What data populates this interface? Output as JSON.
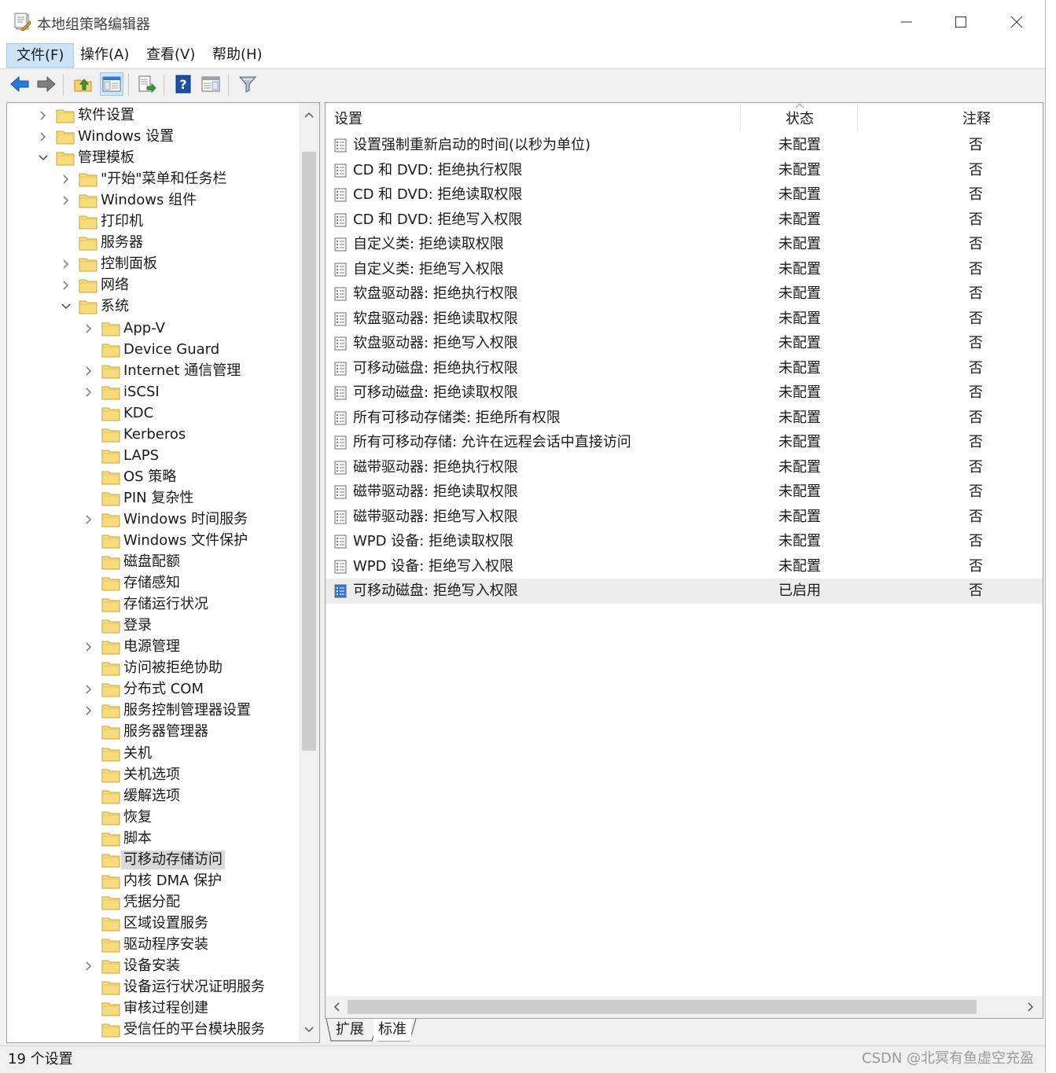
{
  "window": {
    "title": "本地组策略编辑器"
  },
  "menubar": [
    "文件(F)",
    "操作(A)",
    "查看(V)",
    "帮助(H)"
  ],
  "tree": {
    "items": [
      {
        "label": "软件设置",
        "depth": 1,
        "chevron": "right"
      },
      {
        "label": "Windows 设置",
        "depth": 1,
        "chevron": "right"
      },
      {
        "label": "管理模板",
        "depth": 1,
        "chevron": "down"
      },
      {
        "label": "\"开始\"菜单和任务栏",
        "depth": 2,
        "chevron": "right"
      },
      {
        "label": "Windows 组件",
        "depth": 2,
        "chevron": "right"
      },
      {
        "label": "打印机",
        "depth": 2,
        "chevron": "none"
      },
      {
        "label": "服务器",
        "depth": 2,
        "chevron": "none"
      },
      {
        "label": "控制面板",
        "depth": 2,
        "chevron": "right"
      },
      {
        "label": "网络",
        "depth": 2,
        "chevron": "right"
      },
      {
        "label": "系统",
        "depth": 2,
        "chevron": "down"
      },
      {
        "label": "App-V",
        "depth": 3,
        "chevron": "right"
      },
      {
        "label": "Device Guard",
        "depth": 3,
        "chevron": "none"
      },
      {
        "label": "Internet 通信管理",
        "depth": 3,
        "chevron": "right"
      },
      {
        "label": "iSCSI",
        "depth": 3,
        "chevron": "right"
      },
      {
        "label": "KDC",
        "depth": 3,
        "chevron": "none"
      },
      {
        "label": "Kerberos",
        "depth": 3,
        "chevron": "none"
      },
      {
        "label": "LAPS",
        "depth": 3,
        "chevron": "none"
      },
      {
        "label": "OS 策略",
        "depth": 3,
        "chevron": "none"
      },
      {
        "label": "PIN 复杂性",
        "depth": 3,
        "chevron": "none"
      },
      {
        "label": "Windows 时间服务",
        "depth": 3,
        "chevron": "right"
      },
      {
        "label": "Windows 文件保护",
        "depth": 3,
        "chevron": "none"
      },
      {
        "label": "磁盘配额",
        "depth": 3,
        "chevron": "none"
      },
      {
        "label": "存储感知",
        "depth": 3,
        "chevron": "none"
      },
      {
        "label": "存储运行状况",
        "depth": 3,
        "chevron": "none"
      },
      {
        "label": "登录",
        "depth": 3,
        "chevron": "none"
      },
      {
        "label": "电源管理",
        "depth": 3,
        "chevron": "right"
      },
      {
        "label": "访问被拒绝协助",
        "depth": 3,
        "chevron": "none"
      },
      {
        "label": "分布式 COM",
        "depth": 3,
        "chevron": "right"
      },
      {
        "label": "服务控制管理器设置",
        "depth": 3,
        "chevron": "right"
      },
      {
        "label": "服务器管理器",
        "depth": 3,
        "chevron": "none"
      },
      {
        "label": "关机",
        "depth": 3,
        "chevron": "none"
      },
      {
        "label": "关机选项",
        "depth": 3,
        "chevron": "none"
      },
      {
        "label": "缓解选项",
        "depth": 3,
        "chevron": "none"
      },
      {
        "label": "恢复",
        "depth": 3,
        "chevron": "none"
      },
      {
        "label": "脚本",
        "depth": 3,
        "chevron": "none"
      },
      {
        "label": "可移动存储访问",
        "depth": 3,
        "chevron": "none",
        "selected": true
      },
      {
        "label": "内核 DMA 保护",
        "depth": 3,
        "chevron": "none"
      },
      {
        "label": "凭据分配",
        "depth": 3,
        "chevron": "none"
      },
      {
        "label": "区域设置服务",
        "depth": 3,
        "chevron": "none"
      },
      {
        "label": "驱动程序安装",
        "depth": 3,
        "chevron": "none"
      },
      {
        "label": "设备安装",
        "depth": 3,
        "chevron": "right"
      },
      {
        "label": "设备运行状况证明服务",
        "depth": 3,
        "chevron": "none"
      },
      {
        "label": "审核过程创建",
        "depth": 3,
        "chevron": "none"
      },
      {
        "label": "受信任的平台模块服务",
        "depth": 3,
        "chevron": "none"
      }
    ]
  },
  "list": {
    "columns": {
      "setting": "设置",
      "state": "状态",
      "comment": "注释"
    },
    "rows": [
      {
        "name": "设置强制重新启动的时间(以秒为单位)",
        "state": "未配置",
        "comment": "否"
      },
      {
        "name": "CD 和 DVD: 拒绝执行权限",
        "state": "未配置",
        "comment": "否"
      },
      {
        "name": "CD 和 DVD: 拒绝读取权限",
        "state": "未配置",
        "comment": "否"
      },
      {
        "name": "CD 和 DVD: 拒绝写入权限",
        "state": "未配置",
        "comment": "否"
      },
      {
        "name": "自定义类: 拒绝读取权限",
        "state": "未配置",
        "comment": "否"
      },
      {
        "name": "自定义类: 拒绝写入权限",
        "state": "未配置",
        "comment": "否"
      },
      {
        "name": "软盘驱动器: 拒绝执行权限",
        "state": "未配置",
        "comment": "否"
      },
      {
        "name": "软盘驱动器: 拒绝读取权限",
        "state": "未配置",
        "comment": "否"
      },
      {
        "name": "软盘驱动器: 拒绝写入权限",
        "state": "未配置",
        "comment": "否"
      },
      {
        "name": "可移动磁盘: 拒绝执行权限",
        "state": "未配置",
        "comment": "否"
      },
      {
        "name": "可移动磁盘: 拒绝读取权限",
        "state": "未配置",
        "comment": "否"
      },
      {
        "name": "所有可移动存储类: 拒绝所有权限",
        "state": "未配置",
        "comment": "否"
      },
      {
        "name": "所有可移动存储: 允许在远程会话中直接访问",
        "state": "未配置",
        "comment": "否"
      },
      {
        "name": "磁带驱动器: 拒绝执行权限",
        "state": "未配置",
        "comment": "否"
      },
      {
        "name": "磁带驱动器: 拒绝读取权限",
        "state": "未配置",
        "comment": "否"
      },
      {
        "name": "磁带驱动器: 拒绝写入权限",
        "state": "未配置",
        "comment": "否"
      },
      {
        "name": "WPD 设备: 拒绝读取权限",
        "state": "未配置",
        "comment": "否"
      },
      {
        "name": "WPD 设备: 拒绝写入权限",
        "state": "未配置",
        "comment": "否"
      },
      {
        "name": "可移动磁盘: 拒绝写入权限",
        "state": "已启用",
        "comment": "否",
        "selected": true
      }
    ]
  },
  "tabs": [
    "扩展",
    "标准"
  ],
  "status": {
    "text": "19 个设置"
  },
  "watermark": "CSDN @北冥有鱼虚空充盈",
  "colors": {
    "selection": "#cce4f7",
    "folder": "#f3d26d",
    "accent_blue": "#2b79d8"
  }
}
